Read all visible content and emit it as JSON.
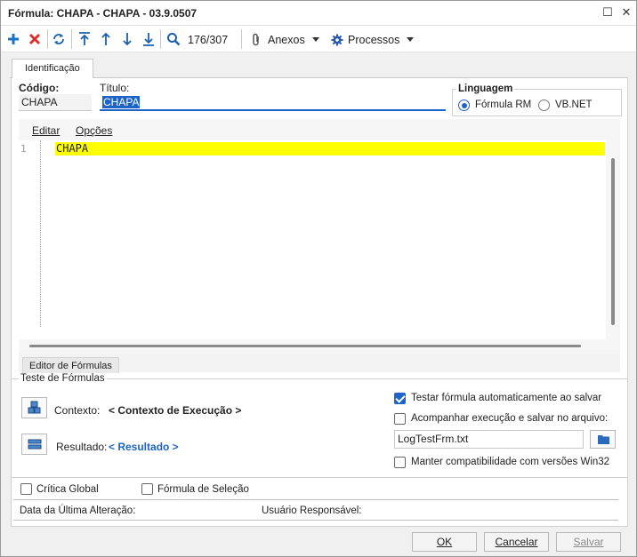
{
  "window": {
    "title": "Fórmula: CHAPA - CHAPA - 03.9.0507",
    "restore_glyph": "☐",
    "close_glyph": "✕"
  },
  "toolbar": {
    "record_position": "176/307",
    "attachments_label": "Anexos",
    "processes_label": "Processos",
    "icons": [
      "add-icon",
      "delete-icon",
      "refresh-icon",
      "first-icon",
      "previous-icon",
      "next-icon",
      "last-icon",
      "search-icon",
      "paperclip-icon",
      "gear-icon"
    ]
  },
  "tabs": {
    "main": "Identificação",
    "editor_tab": "Editor de Fórmulas"
  },
  "identification": {
    "code_label": "Código:",
    "code_value": "CHAPA",
    "title_label": "Título:",
    "title_value": "CHAPA"
  },
  "language": {
    "label": "Linguagem",
    "options": [
      {
        "label": "Fórmula RM",
        "selected": true
      },
      {
        "label": "VB.NET",
        "selected": false
      }
    ]
  },
  "editor": {
    "menu": [
      "Editar",
      "Opções"
    ],
    "line_number": "1",
    "code": "CHAPA",
    "highlight_color": "#ffff00"
  },
  "test": {
    "group_label": "Teste de Fórmulas",
    "context_label": "Contexto:",
    "context_value": "< Contexto de Execução >",
    "result_label": "Resultado:",
    "result_value": "< Resultado >",
    "auto_test_label": "Testar fórmula automaticamente ao salvar",
    "auto_test_checked": true,
    "follow_label": "Acompanhar execução e salvar no arquivo:",
    "follow_checked": false,
    "log_file": "LogTestFrm.txt",
    "compat_label": "Manter compatibilidade com versões Win32",
    "compat_checked": false
  },
  "footer_options": {
    "critica_label": "Crítica Global",
    "selecao_label": "Fórmula de Seleção"
  },
  "audit": {
    "last_change_label": "Data da Última Alteração:",
    "responsible_label": "Usuário Responsável:"
  },
  "buttons": {
    "ok": "OK",
    "cancel": "Cancelar",
    "save": "Salvar"
  },
  "colors": {
    "accent": "#1e64c8",
    "add": "#1a73c8",
    "delete": "#d83030"
  }
}
